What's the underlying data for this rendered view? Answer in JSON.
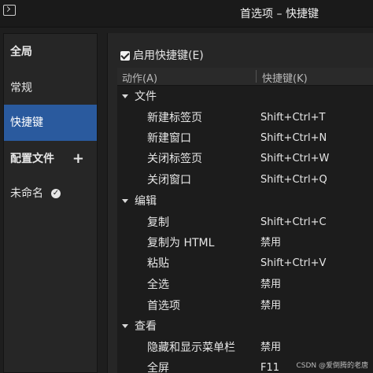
{
  "window": {
    "title": "首选项 – 快捷键"
  },
  "sidebar": {
    "items": [
      {
        "label": "全局",
        "kind": "header"
      },
      {
        "label": "常规",
        "kind": "item"
      },
      {
        "label": "快捷键",
        "kind": "selected"
      },
      {
        "label": "配置文件",
        "kind": "header",
        "action": "+"
      },
      {
        "label": "未命名",
        "kind": "item",
        "badge": "✓"
      }
    ]
  },
  "content": {
    "enable_label": "启用快捷键(E)",
    "columns": {
      "action": "动作(A)",
      "keys": "快捷键(K)"
    },
    "groups": [
      {
        "name": "文件",
        "rows": [
          {
            "action": "新建标签页",
            "keys": "Shift+Ctrl+T"
          },
          {
            "action": "新建窗口",
            "keys": "Shift+Ctrl+N"
          },
          {
            "action": "关闭标签页",
            "keys": "Shift+Ctrl+W"
          },
          {
            "action": "关闭窗口",
            "keys": "Shift+Ctrl+Q"
          }
        ]
      },
      {
        "name": "编辑",
        "rows": [
          {
            "action": "复制",
            "keys": "Shift+Ctrl+C"
          },
          {
            "action": "复制为 HTML",
            "keys": "禁用"
          },
          {
            "action": "粘贴",
            "keys": "Shift+Ctrl+V"
          },
          {
            "action": "全选",
            "keys": "禁用"
          },
          {
            "action": "首选项",
            "keys": "禁用"
          }
        ]
      },
      {
        "name": "查看",
        "rows": [
          {
            "action": "隐藏和显示菜单栏",
            "keys": "禁用"
          },
          {
            "action": "全屏",
            "keys": "F11"
          }
        ]
      }
    ]
  },
  "watermark": "CSDN @爱倒腾的老唐",
  "colors": {
    "selected": "#2a5a9e",
    "background": "#1e1e1e"
  }
}
